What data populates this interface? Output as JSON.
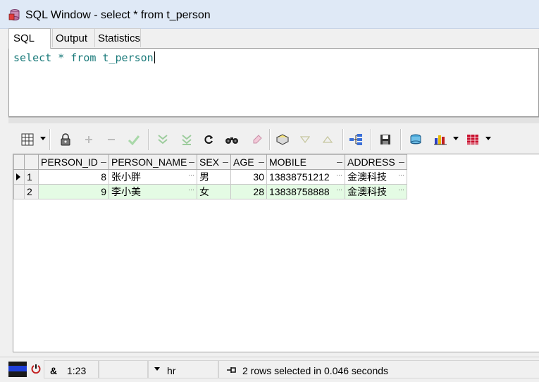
{
  "window": {
    "title": "SQL Window - select * from t_person"
  },
  "tabs": [
    {
      "label": "SQL",
      "active": true
    },
    {
      "label": "Output",
      "active": false
    },
    {
      "label": "Statistics",
      "active": false
    }
  ],
  "editor": {
    "sql": "select * from t_person"
  },
  "toolbar": {
    "icons": [
      "grid-menu-icon",
      "lock-icon",
      "add-record-icon",
      "delete-record-icon",
      "post-record-icon",
      "fetch-next-icon",
      "fetch-last-icon",
      "refresh-icon",
      "find-icon",
      "clear-icon",
      "export-icon",
      "filter-down-icon",
      "filter-up-icon",
      "query-plan-icon",
      "save-icon",
      "sql-query-icon",
      "chart-icon",
      "table-export-icon"
    ]
  },
  "grid": {
    "columns": [
      "PERSON_ID",
      "PERSON_NAME",
      "SEX",
      "AGE",
      "MOBILE",
      "ADDRESS"
    ],
    "rows": [
      {
        "num": "1",
        "current": true,
        "cells": [
          "8",
          "张小胖",
          "男",
          "30",
          "13838751212",
          "金澳科技"
        ]
      },
      {
        "num": "2",
        "current": false,
        "cells": [
          "9",
          "李小美",
          "女",
          "28",
          "13838758888",
          "金澳科技"
        ]
      }
    ],
    "cell_ellipsis": "…",
    "row_stripe_color": "#e4fbe4"
  },
  "statusbar": {
    "position": "1:23",
    "schema": "hr",
    "message": "2 rows selected in 0.046 seconds",
    "amp_label": "&"
  }
}
